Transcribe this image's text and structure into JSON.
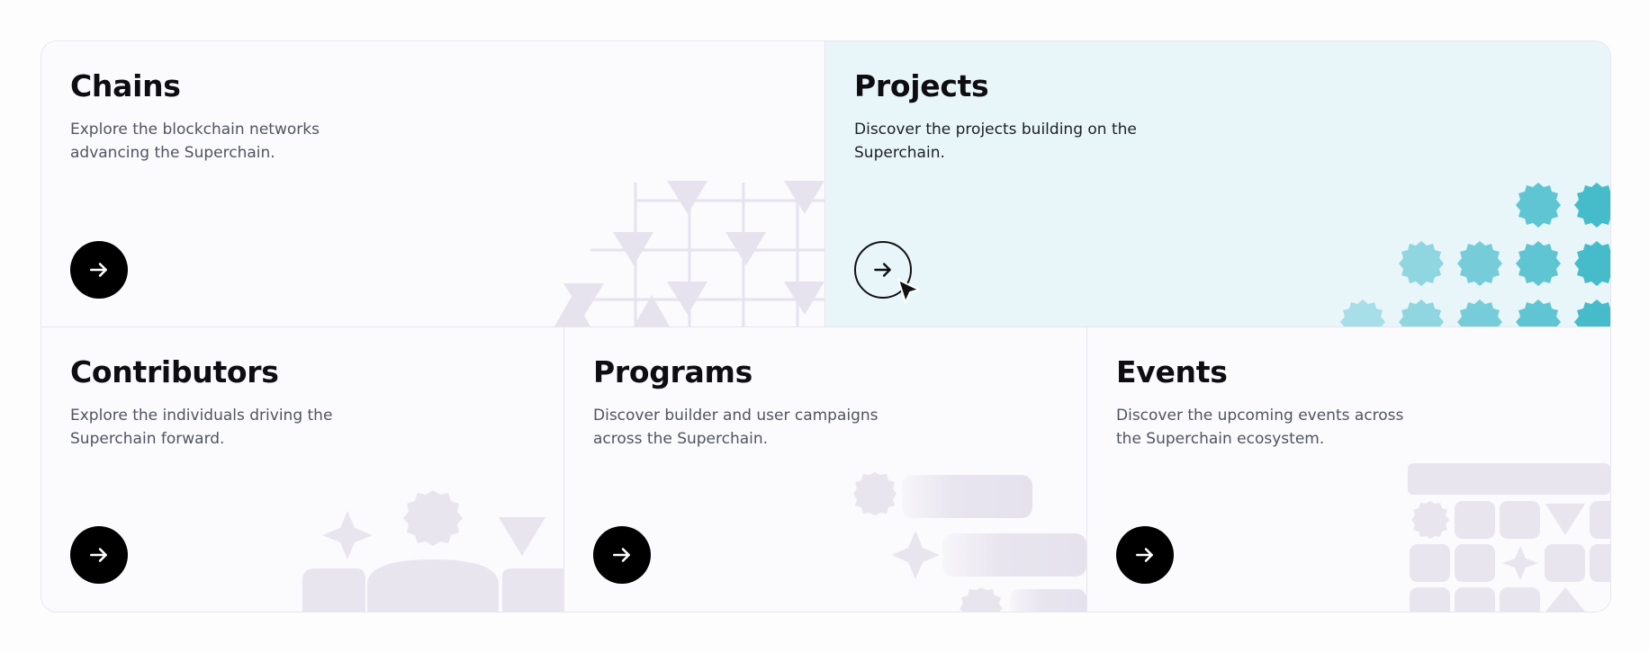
{
  "cards": {
    "chains": {
      "title": "Chains",
      "description": "Explore the blockchain networks advancing the Superchain."
    },
    "projects": {
      "title": "Projects",
      "description": "Discover the projects building on the Superchain."
    },
    "contributors": {
      "title": "Contributors",
      "description": "Explore the individuals driving the Superchain forward."
    },
    "programs": {
      "title": "Programs",
      "description": "Discover builder and user campaigns across the Superchain."
    },
    "events": {
      "title": "Events",
      "description": "Discover the upcoming events across the Superchain ecosystem."
    }
  },
  "icons": {
    "arrow": "arrow-right-icon",
    "cursor": "mouse-pointer-icon"
  },
  "colors": {
    "accent_hover": "#e8f6fa",
    "teal": "#4fc2d0",
    "button": "#000000"
  }
}
